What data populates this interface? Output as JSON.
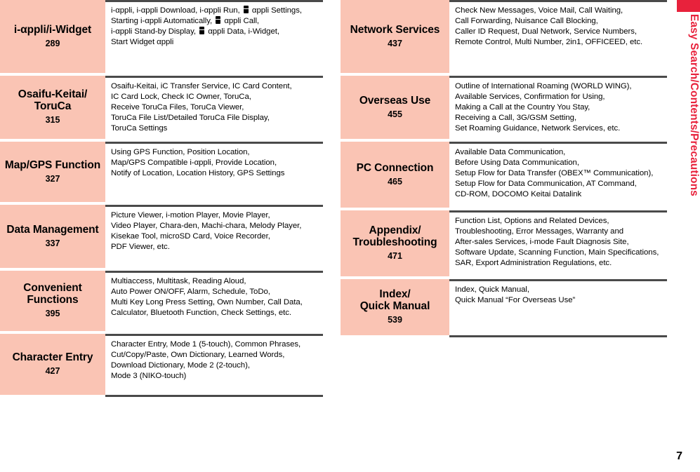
{
  "side_tab": {
    "label": "Easy Search/Contents/Precautions",
    "color": "#e8223c"
  },
  "page_number": "7",
  "theme": {
    "category_bg": "#fac4b4",
    "rule_color": "#4a4a4a",
    "text_color": "#000000"
  },
  "columns": [
    {
      "id": "left",
      "rows": [
        {
          "title": "i-αppli/i-Widget",
          "page": "289",
          "lines": [
            "i-αppli, i-αppli Download, i-αppli Run, □ αppli Settings,",
            "Starting i-αppli Automatically, □ αppli Call,",
            "i-αppli Stand-by Display, □ αppli Data, i-Widget,",
            "Start Widget αppli"
          ]
        },
        {
          "title": "Osaifu-Keitai/\nToruCa",
          "page": "315",
          "lines": [
            "Osaifu-Keitai, iC Transfer Service, IC Card Content,",
            "IC Card Lock, Check IC Owner, ToruCa,",
            "Receive ToruCa Files, ToruCa Viewer,",
            "ToruCa File List/Detailed ToruCa File Display,",
            "ToruCa Settings"
          ]
        },
        {
          "title": "Map/GPS Function",
          "page": "327",
          "lines": [
            "Using GPS Function, Position Location,",
            "Map/GPS Compatible i-αppli, Provide Location,",
            "Notify of Location, Location History, GPS Settings"
          ]
        },
        {
          "title": "Data Management",
          "page": "337",
          "lines": [
            "Picture Viewer, i-motion Player, Movie Player,",
            "Video Player, Chara-den, Machi-chara, Melody Player,",
            "Kisekae Tool, microSD Card, Voice Recorder,",
            "PDF Viewer, etc."
          ]
        },
        {
          "title": "Convenient\nFunctions",
          "page": "395",
          "lines": [
            "Multiaccess, Multitask, Reading Aloud,",
            "Auto Power ON/OFF, Alarm, Schedule, ToDo,",
            "Multi Key Long Press Setting, Own Number, Call Data,",
            "Calculator, Bluetooth Function, Check Settings, etc."
          ]
        },
        {
          "title": "Character Entry",
          "page": "427",
          "lines": [
            "Character Entry, Mode 1 (5-touch), Common Phrases,",
            "Cut/Copy/Paste, Own Dictionary, Learned Words,",
            "Download Dictionary, Mode 2 (2-touch),",
            "Mode 3 (NIKO-touch)"
          ]
        }
      ]
    },
    {
      "id": "right",
      "rows": [
        {
          "title": "Network Services",
          "page": "437",
          "lines": [
            "Check New Messages, Voice Mail, Call Waiting,",
            "Call Forwarding, Nuisance Call Blocking,",
            "Caller ID Request, Dual Network, Service Numbers,",
            "Remote Control, Multi Number, 2in1, OFFICEED, etc."
          ]
        },
        {
          "title": "Overseas Use",
          "page": "455",
          "lines": [
            "Outline of International Roaming (WORLD WING),",
            "Available Services, Confirmation for Using,",
            "Making a Call at the Country You Stay,",
            "Receiving a Call, 3G/GSM Setting,",
            "Set Roaming Guidance, Network Services, etc."
          ]
        },
        {
          "title": "PC Connection",
          "page": "465",
          "lines": [
            "Available Data Communication,",
            "Before Using Data Communication,",
            "Setup Flow for Data Transfer (OBEX™ Communication),",
            "Setup Flow for Data Communication, AT Command,",
            "CD-ROM, DOCOMO Keitai Datalink"
          ]
        },
        {
          "title": "Appendix/\nTroubleshooting",
          "page": "471",
          "lines": [
            "Function List, Options and Related Devices,",
            "Troubleshooting, Error Messages, Warranty and",
            "After-sales Services, i-mode Fault Diagnosis Site,",
            "Software Update, Scanning Function, Main Specifications,",
            "SAR, Export Administration Regulations, etc."
          ]
        },
        {
          "title": "Index/\nQuick Manual",
          "page": "539",
          "lines": [
            "Index, Quick Manual,",
            "Quick Manual “For Overseas Use”"
          ]
        }
      ]
    }
  ]
}
